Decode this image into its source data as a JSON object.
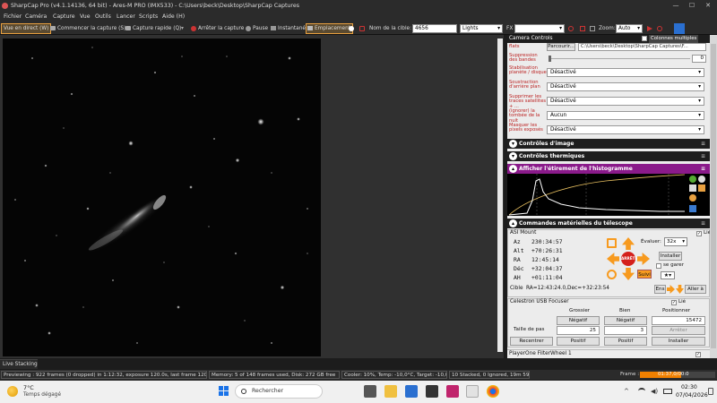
{
  "window": {
    "title": "SharpCap Pro (v4.1.14136, 64 bit) - Ares-M PRO (IMX533) - C:\\Users\\beck\\Desktop\\SharpCap Captures",
    "minimize": "—",
    "maximize": "☐",
    "close": "✕"
  },
  "menu": [
    "Fichier",
    "Caméra",
    "Capture",
    "Vue",
    "Outils",
    "Lancer",
    "Scripts",
    "Aide (H)"
  ],
  "toolbar": {
    "live_view": "Vue en direct (W)",
    "start_capture": "Commencer la capture (S)",
    "quick_capture": "Capture rapide (Q)",
    "stop_capture": "Arrêter la capture",
    "pause": "Pause",
    "snapshot": "Instantané",
    "placement": "Emplacement",
    "target_name_label": "Nom de la cible:",
    "target_name_value": "4656",
    "frame_type": "Lights",
    "fx_label": "FX",
    "fx_value": "",
    "zoom_label": "Zoom:",
    "zoom_value": "Auto"
  },
  "camera_controls": {
    "title": "Camera Controls",
    "multiple_columns": "Colonnes multiples",
    "flats_label": "flats",
    "flats_button": "Parcourir...",
    "flats_path": "C:\\Users\\beck\\Desktop\\SharpCap Captures\\F...",
    "band_suppression_label": "Suppression des bandes",
    "band_suppression_value": "0",
    "rows": [
      {
        "label": "Stabilisation planète / disque",
        "value": "Désactivé"
      },
      {
        "label": "Soustraction d'arrière plan",
        "value": "Désactivé"
      },
      {
        "label": "Supprimer les traces satellites + ...",
        "value": "Désactivé"
      },
      {
        "label": "(ignorer) la tombée de la nuit",
        "value": "Aucun"
      },
      {
        "label": "Masquer les pixels exposés",
        "value": "Désactivé"
      }
    ]
  },
  "sections": {
    "image_controls": "Contrôles d'image",
    "thermal_controls": "Contrôles thermiques",
    "histogram": "Afficher l'étirement de l'histogramme",
    "telescope": "Commandes matérielles du télescope"
  },
  "mount": {
    "name": "ASI Mount",
    "connected_label": "Lié",
    "az": {
      "label": "Az",
      "value": "230:34:57"
    },
    "alt": {
      "label": "Alt",
      "value": "+70:26:31"
    },
    "ra": {
      "label": "RA",
      "value": "12:45:14"
    },
    "dec": {
      "label": "Déc",
      "value": "+32:04:37"
    },
    "ah": {
      "label": "AH",
      "value": "+01:11:04"
    },
    "rate_label": "Évaluer:",
    "rate_value": "32x",
    "install": "Installer",
    "park": "se garer",
    "stop": "ARRÊTE",
    "follow": "Suivi",
    "target_label": "Cible",
    "target_value": "RA=12:43:24.0,Dec=+32:23:54",
    "goto": "Aller à",
    "ens": "Ens"
  },
  "focuser": {
    "name": "Celestron USB Focuser",
    "connected_label": "Lié",
    "col_coarse": "Grossier",
    "col_fine": "Bien",
    "col_position": "Positionner",
    "negative": "Négatif",
    "positive": "Positif",
    "position_value": "15472",
    "step_label": "Taille de pas",
    "step_coarse": "25",
    "step_fine": "3",
    "stop": "Arrêter",
    "recenter": "Recentrer",
    "install": "Installer"
  },
  "filter_wheel": "PlayerOne FilterWheel 1",
  "live_stacking": "Live Stacking",
  "status": {
    "previewing": "Previewing : 922 frames (0 dropped) in 1:12:32, exposure 120.0s, last frame 120.0s",
    "memory": "Memory: 5 of 148 frames used, Disk: 272 GB free",
    "cooler": "Cooler: 10%, Temp: -10,0°C, Target: -10,0°C",
    "stacked": "10 Stacked, 0 Ignored, 19m 59s",
    "frame_label": "Frame :",
    "frame_time": "01:37,0/00:0",
    "frame_progress": 0.55
  },
  "taskbar": {
    "weather_temp": "7°C",
    "weather_desc": "Temps dégagé",
    "search_placeholder": "Rechercher",
    "time": "02:30",
    "date": "07/04/2026"
  },
  "colors": {
    "accent_orange": "#e8a040",
    "histogram_purple": "#8a1a8a",
    "frame_bar": "#f08000",
    "arrow_orange": "#f79a1e"
  }
}
